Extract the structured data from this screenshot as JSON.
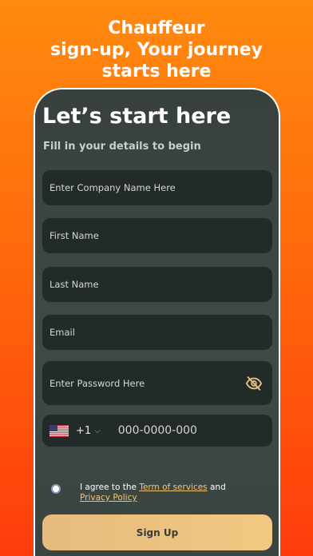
{
  "headline": {
    "line1": "Chauffeur",
    "line2": "sign-up, Your journey",
    "line3": "starts here"
  },
  "form": {
    "title": "Let’s start here",
    "subtitle": "Fill in your details to begin",
    "company_placeholder": "Enter Company Name Here",
    "first_name_placeholder": "First Name",
    "last_name_placeholder": "Last Name",
    "email_placeholder": "Email",
    "password_placeholder": "Enter Password Here",
    "password_icon": "eye-slash-icon",
    "phone": {
      "country_flag": "us-flag-icon",
      "dial_code": "+1",
      "chevron": "⌵",
      "placeholder": "000-0000-000"
    },
    "agree": {
      "prefix": "I agree to the ",
      "terms_link": "Term of services",
      "middle": " and ",
      "privacy_link": " Privacy Policy"
    },
    "submit_label": "Sign Up"
  },
  "colors": {
    "bg_top": "#ff8a0f",
    "bg_bottom": "#ff3c0c",
    "panel": "#3e4a46",
    "field": "#232b29",
    "accent": "#f2c57a",
    "button": "#eec37f"
  }
}
